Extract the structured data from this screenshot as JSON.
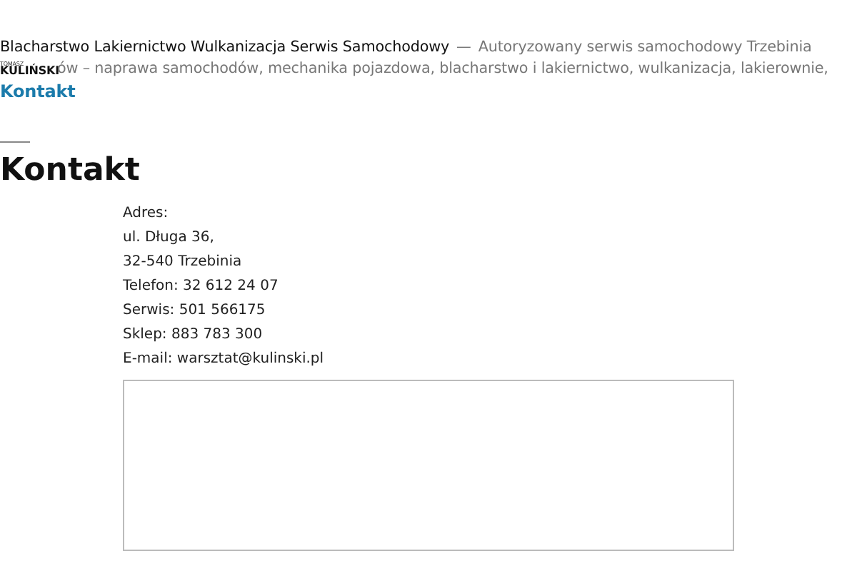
{
  "header": {
    "logo": {
      "top": "TOMASZ",
      "bottom": "KULIŃSKI"
    },
    "site_title": "Blacharstwo Lakiernictwo Wulkanizacja Serwis Samochodowy",
    "separator": "—",
    "tagline_line_1": "Autoryzowany serwis samochodowy Trzebinia",
    "tagline_line_2": "ów – naprawa samochodów, mechanika pojazdowa, blacharstwo i lakiernictwo, wulkanizacja, lakierownie,"
  },
  "breadcrumb": "Kontakt",
  "page_title": "Kontakt",
  "contact_lines": [
    "Adres:",
    "ul. Długa 36,",
    "32-540 Trzebinia",
    "Telefon: 32 612 24 07",
    "Serwis: 501 566175",
    "Sklep: 883 783 300",
    "E-mail: warsztat@kulinski.pl"
  ],
  "map": {
    "kind": "frame"
  }
}
